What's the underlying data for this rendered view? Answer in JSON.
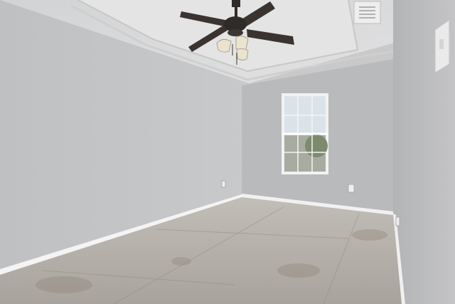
{
  "scene": {
    "subject": "empty-room",
    "elements": [
      "ceiling-fan",
      "window",
      "air-vent",
      "light-switch",
      "outlet",
      "baseboard",
      "concrete-floor"
    ]
  },
  "colors": {
    "left_wall": "#c4c5c7",
    "back_wall": "#b9babc",
    "right_wall": "#bdbdbf",
    "ceiling": "#d9dadb",
    "tray_ceiling": "#e6e6e7",
    "floor": "#b4b0aa",
    "baseboard": "#f4f4f4",
    "fan_blade": "#3a3330",
    "window_frame": "#f2f2f2",
    "window_glass": "#dbe3ea"
  }
}
